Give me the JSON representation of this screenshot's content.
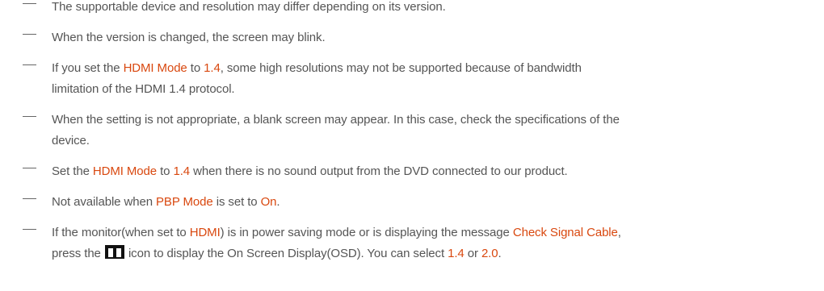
{
  "notes": [
    {
      "lines": [
        [
          {
            "t": "The supportable device and resolution may differ depending on its version."
          }
        ]
      ]
    },
    {
      "lines": [
        [
          {
            "t": "When the version is changed, the screen may blink."
          }
        ]
      ]
    },
    {
      "lines": [
        [
          {
            "t": "If you set the "
          },
          {
            "t": "HDMI Mode",
            "hl": true
          },
          {
            "t": " to "
          },
          {
            "t": "1.4",
            "hl": true
          },
          {
            "t": ", some high resolutions may not be supported because of bandwidth"
          }
        ],
        [
          {
            "t": "limitation of the HDMI 1.4 protocol."
          }
        ]
      ]
    },
    {
      "lines": [
        [
          {
            "t": "When the setting is not appropriate, a blank screen may appear. In this case, check the specifications of the"
          }
        ],
        [
          {
            "t": "device."
          }
        ]
      ]
    },
    {
      "lines": [
        [
          {
            "t": "Set the "
          },
          {
            "t": "HDMI Mode",
            "hl": true
          },
          {
            "t": " to "
          },
          {
            "t": "1.4",
            "hl": true
          },
          {
            "t": " when there is no sound output from the DVD connected to our product."
          }
        ]
      ]
    },
    {
      "lines": [
        [
          {
            "t": "Not available when "
          },
          {
            "t": "PBP Mode",
            "hl": true
          },
          {
            "t": " is set to "
          },
          {
            "t": "On",
            "hl": true
          },
          {
            "t": "."
          }
        ]
      ]
    },
    {
      "lines": [
        [
          {
            "t": "If the monitor(when set to "
          },
          {
            "t": "HDMI",
            "hl": true
          },
          {
            "t": ") is in power saving mode or is displaying the message "
          },
          {
            "t": "Check Signal Cable",
            "hl": true
          },
          {
            "t": ","
          }
        ],
        [
          {
            "t": "press the "
          },
          {
            "icon": "menu-grid-icon"
          },
          {
            "t": " icon to display the On Screen Display(OSD). You can select "
          },
          {
            "t": "1.4",
            "hl": true
          },
          {
            "t": " or "
          },
          {
            "t": "2.0",
            "hl": true
          },
          {
            "t": "."
          }
        ]
      ]
    }
  ],
  "colors": {
    "text": "#555555",
    "highlight": "#d9480f",
    "dash": "#666666",
    "icon": "#111111"
  }
}
